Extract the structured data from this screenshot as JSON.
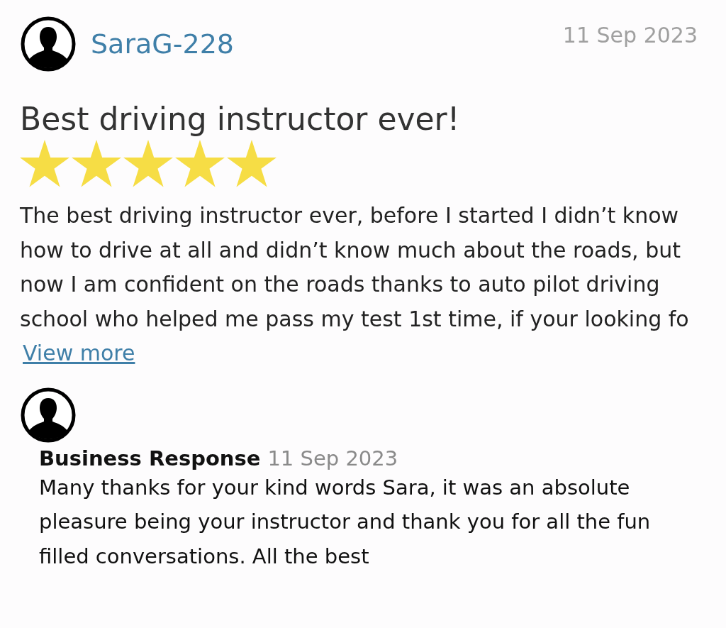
{
  "review": {
    "author": "SaraG-228",
    "date": "11 Sep 2023",
    "title": "Best driving instructor ever!",
    "stars": 5,
    "body": "The best driving instructor ever, before I started I didn’t know how to drive at all and didn’t know much about the roads, but now I am confident on the roads thanks to auto pilot driving school who helped me pass my test 1st time, if your looking fo",
    "more_link": "View more"
  },
  "response": {
    "label": "Business Response",
    "date": "11 Sep 2023",
    "text": "Many thanks for your kind words Sara, it was an absolute pleasure being your instructor and thank you for all the fun filled conversations. All the best"
  }
}
